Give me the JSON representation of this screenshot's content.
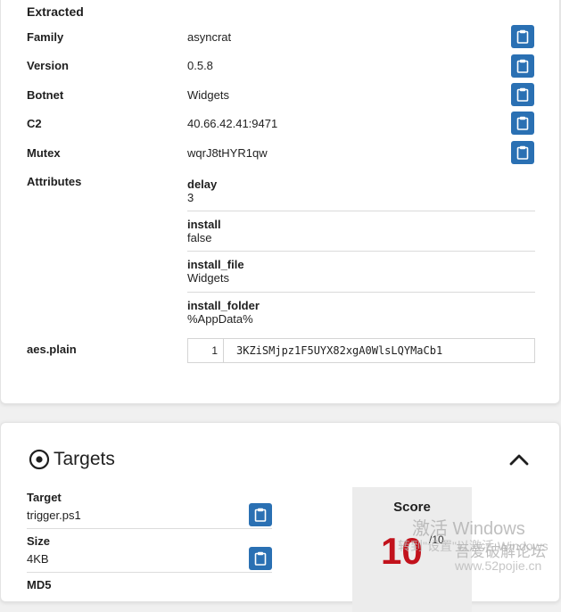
{
  "extracted": {
    "title": "Extracted",
    "rows": [
      {
        "label": "Family",
        "value": "asyncrat"
      },
      {
        "label": "Version",
        "value": "0.5.8"
      },
      {
        "label": "Botnet",
        "value": "Widgets"
      },
      {
        "label": "C2",
        "value": "40.66.42.41:9471"
      },
      {
        "label": "Mutex",
        "value": "wqrJ8tHYR1qw"
      }
    ],
    "attributes_label": "Attributes",
    "attributes": [
      {
        "key": "delay",
        "value": "3"
      },
      {
        "key": "install",
        "value": "false"
      },
      {
        "key": "install_file",
        "value": "Widgets"
      },
      {
        "key": "install_folder",
        "value": "%AppData%"
      }
    ],
    "aes_label": "aes.plain",
    "aes_line_number": "1",
    "aes_value": "3KZiSMjpz1F5UYX82xgA0WlsLQYMaCb1"
  },
  "targets": {
    "title": "Targets",
    "target_label": "Target",
    "target_value": "trigger.ps1",
    "size_label": "Size",
    "size_value": "4KB",
    "next_label": "MD5",
    "score_label": "Score",
    "score_value": "10",
    "score_max": "/10"
  },
  "watermark": {
    "line1": "激活 Windows",
    "line2": "转到\"设置\"以激活 Windows",
    "site": "吾爱破解论坛",
    "url": "www.52pojie.cn"
  },
  "colors": {
    "copy_button": "#2a70b3",
    "score_red": "#c2121c"
  }
}
